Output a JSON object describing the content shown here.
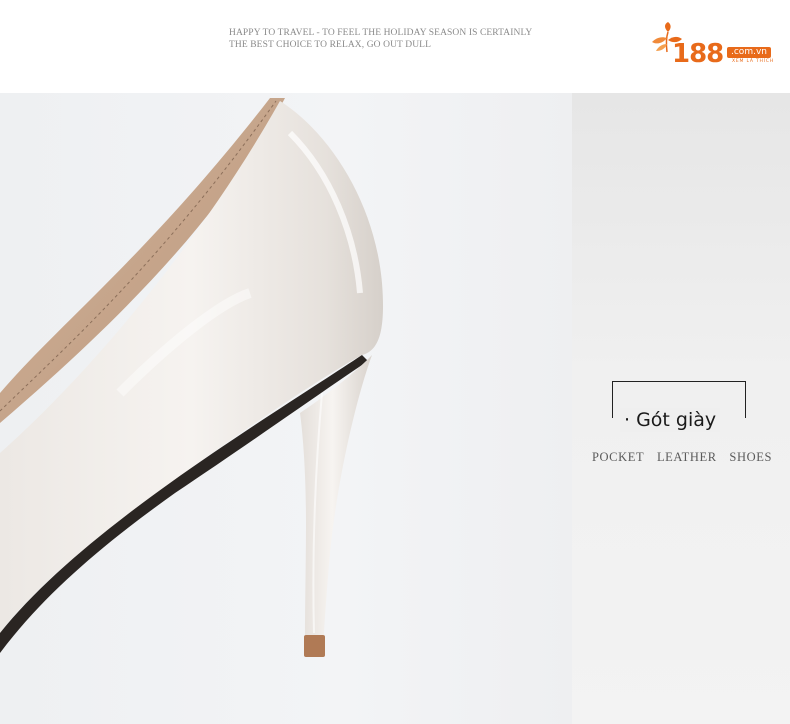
{
  "header": {
    "tagline_line1": "HAPPY TO TRAVEL - TO FEEL THE HOLIDAY SEASON IS CERTAINLY",
    "tagline_line2": "THE BEST CHOICE TO RELAX, GO OUT DULL"
  },
  "logo": {
    "number": "188",
    "domain": ".com.vn",
    "slogan": "XEM LÀ THÍCH",
    "brand_color": "#e86a1a",
    "icon": "leaf-icon"
  },
  "feature": {
    "label": "· Gót giày",
    "subtitle": [
      "POCKET",
      "LEATHER",
      "SHOES"
    ]
  },
  "colors": {
    "shoe": "#f1ede9",
    "lining": "#c9a88f",
    "heel_tip": "#b07a55"
  }
}
